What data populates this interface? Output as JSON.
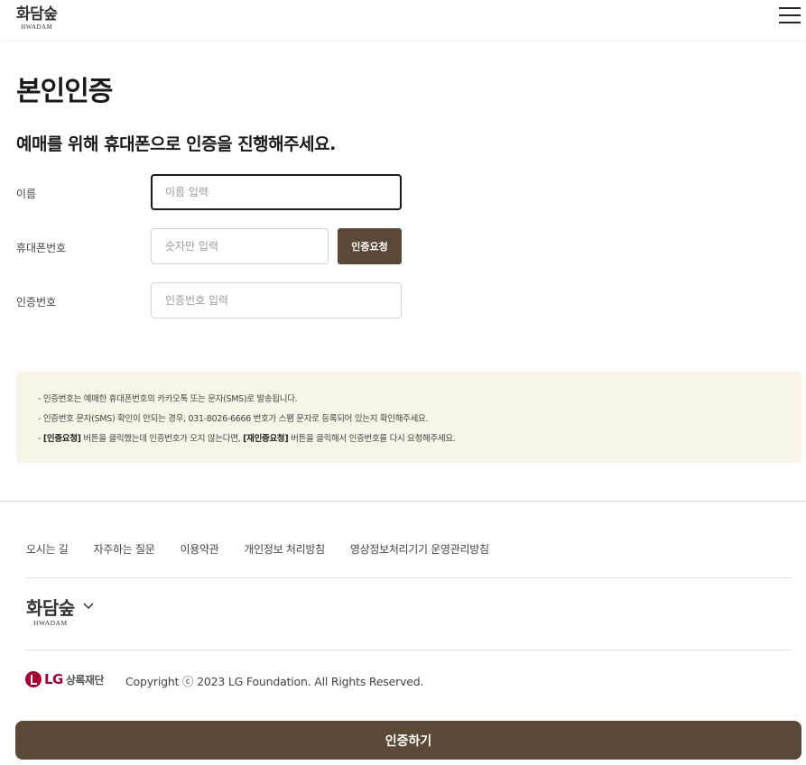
{
  "header": {
    "logo_ko": "화담숲",
    "logo_en": "HWADAM"
  },
  "page_title": "본인인증",
  "subtitle": "예매를 위해 휴대폰으로 인증을 진행해주세요.",
  "form": {
    "name_label": "이름",
    "name_placeholder": "이름 입력",
    "phone_label": "휴대폰번호",
    "phone_placeholder": "숫자만 입력",
    "request_button": "인증요청",
    "code_label": "인증번호",
    "code_placeholder": "인증번호 입력"
  },
  "notice": {
    "item1": "- 인증번호는 예매한 휴대폰번호의 카카오톡 또는 문자(SMS)로 발송됩니다.",
    "item2": "- 인증번호 문자(SMS) 확인이 안되는 경우, 031-8026-6666 번호가 스팸 문자로 등록되어 있는지 확인해주세요.",
    "item3_prefix": "- ",
    "item3_bold1": "[인증요청]",
    "item3_mid": " 버튼을 클릭했는데 인증번호가 오지 않는다면, ",
    "item3_bold2": "[재인증요청]",
    "item3_suffix": " 버튼을 클릭해서 인증번호를 다시 요청해주세요."
  },
  "footer": {
    "links": [
      "오시는 길",
      "자주하는 질문",
      "이용약관",
      "개인정보 처리방침",
      "영상정보처리기기 운영관리방침"
    ],
    "logo_ko": "화담숲",
    "logo_en": "HWADAM",
    "lg_text": "LG",
    "lg_sub": "상록재단",
    "copyright": "Copyright ⓒ 2023 LG Foundation. All Rights Reserved."
  },
  "submit_button": "인증하기",
  "colors": {
    "brand_brown": "#5b4837",
    "notice_bg": "#f8f5e8",
    "lg_red": "#a50034"
  }
}
